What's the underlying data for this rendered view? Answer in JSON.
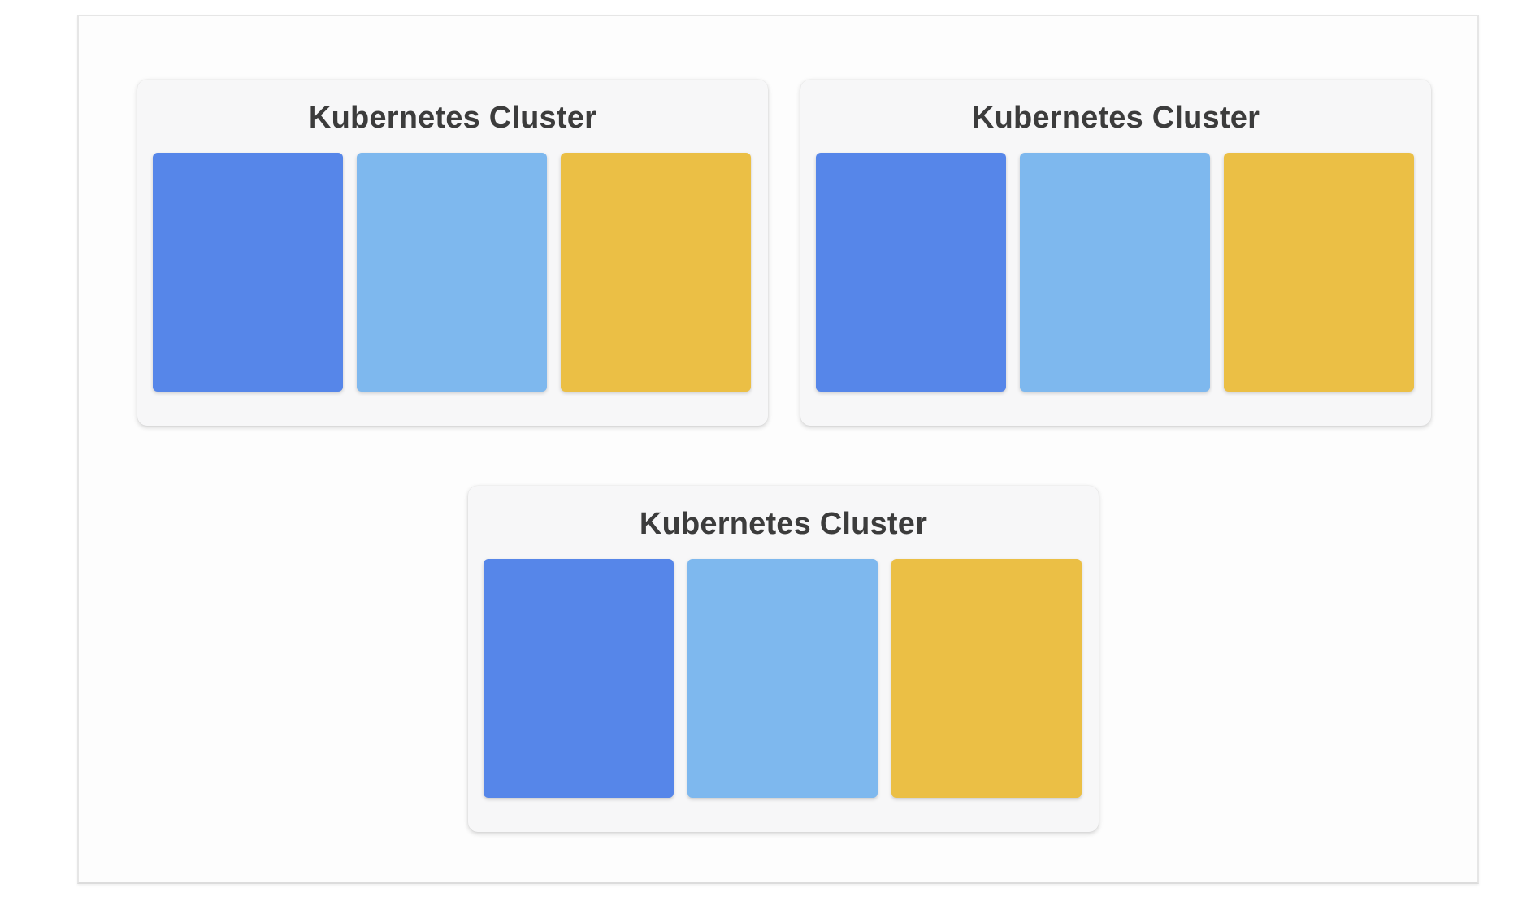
{
  "colors": {
    "block_1": "#5686e9",
    "block_2": "#7eb8ee",
    "block_3": "#ebbf45"
  },
  "clusters": [
    {
      "title": "Kubernetes Cluster"
    },
    {
      "title": "Kubernetes Cluster"
    },
    {
      "title": "Kubernetes Cluster"
    }
  ]
}
